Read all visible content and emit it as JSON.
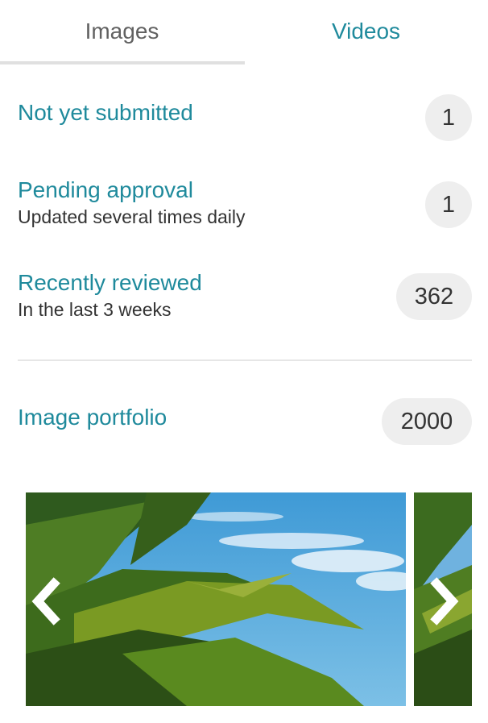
{
  "tabs": [
    {
      "label": "Images",
      "active": true
    },
    {
      "label": "Videos",
      "active": false
    }
  ],
  "stats": {
    "not_submitted": {
      "title": "Not yet submitted",
      "count": "1"
    },
    "pending": {
      "title": "Pending approval",
      "subtitle": "Updated several times daily",
      "count": "1"
    },
    "reviewed": {
      "title": "Recently reviewed",
      "subtitle": "In the last 3 weeks",
      "count": "362"
    },
    "portfolio": {
      "title": "Image portfolio",
      "count": "2000"
    }
  },
  "carousel": {
    "prev_icon": "chevron-left-icon",
    "next_icon": "chevron-right-icon"
  },
  "colors": {
    "accent": "#1f8a9c",
    "badge_bg": "#eeeeee",
    "sky": "#4aa3d8"
  }
}
